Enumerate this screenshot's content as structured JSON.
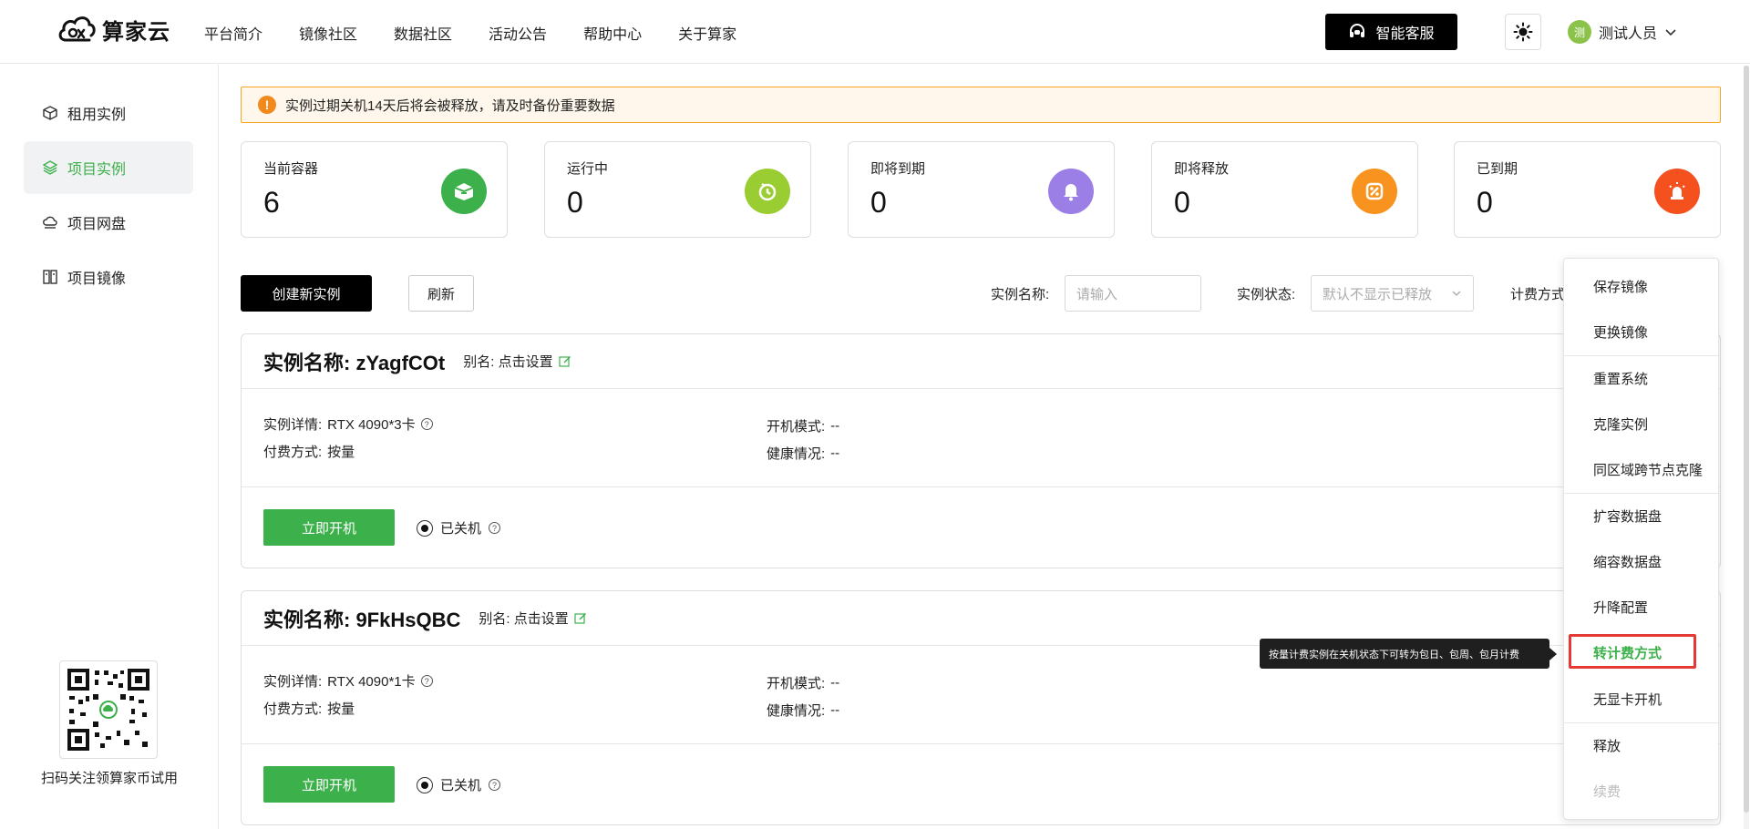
{
  "brand": {
    "name": "算家云"
  },
  "nav": [
    "平台简介",
    "镜像社区",
    "数据社区",
    "活动公告",
    "帮助中心",
    "关于算家"
  ],
  "header": {
    "service_label": "智能客服",
    "user_avatar_text": "测",
    "user_name": "测试人员"
  },
  "sidebar": {
    "items": [
      {
        "label": "租用实例",
        "icon": "cube-icon"
      },
      {
        "label": "项目实例",
        "icon": "layers-icon",
        "active": true
      },
      {
        "label": "项目网盘",
        "icon": "cloud-drive-icon"
      },
      {
        "label": "项目镜像",
        "icon": "image-stack-icon"
      }
    ],
    "qr_caption": "扫码关注领算家币试用"
  },
  "alert": {
    "text": "实例过期关机14天后将会被释放，请及时备份重要数据"
  },
  "stats": [
    {
      "label": "当前容器",
      "value": "6",
      "color": "#3cb04a"
    },
    {
      "label": "运行中",
      "value": "0",
      "color": "#9acd32"
    },
    {
      "label": "即将到期",
      "value": "0",
      "color": "#9b7fe6"
    },
    {
      "label": "即将释放",
      "value": "0",
      "color": "#f7931e"
    },
    {
      "label": "已到期",
      "value": "0",
      "color": "#f4511e"
    }
  ],
  "toolbar": {
    "create_label": "创建新实例",
    "refresh_label": "刷新",
    "name_filter_label": "实例名称:",
    "name_filter_placeholder": "请输入",
    "status_filter_label": "实例状态:",
    "status_filter_placeholder": "默认不显示已释放",
    "billing_filter_label": "计费方式"
  },
  "instances": [
    {
      "title": "实例名称:  zYagfCOt",
      "alias": "别名: 点击设置",
      "detail_label": "实例详情:",
      "detail_value": "RTX 4090*3卡",
      "pay_label": "付费方式:",
      "pay_value": "按量",
      "boot_label": "开机模式:",
      "boot_value": "--",
      "health_label": "健康情况:",
      "health_value": "--",
      "start_label": "立即开机",
      "status": "已关机"
    },
    {
      "title": "实例名称:  9FkHsQBC",
      "alias": "别名: 点击设置",
      "detail_label": "实例详情:",
      "detail_value": "RTX 4090*1卡",
      "pay_label": "付费方式:",
      "pay_value": "按量",
      "boot_label": "开机模式:",
      "boot_value": "--",
      "health_label": "健康情况:",
      "health_value": "--",
      "start_label": "立即开机",
      "status": "已关机"
    }
  ],
  "menu": {
    "items": [
      "保存镜像",
      "更换镜像",
      "重置系统",
      "克隆实例",
      "同区域跨节点克隆",
      "扩容数据盘",
      "缩容数据盘",
      "升降配置",
      "转计费方式",
      "无显卡开机",
      "释放",
      "续费"
    ],
    "highlighted": "转计费方式",
    "disabled": "续费"
  },
  "tooltip": {
    "text": "按量计费实例在关机状态下可转为包日、包周、包月计费"
  },
  "colors": {
    "accent": "#3cb04a",
    "warning": "#f6a623",
    "highlight_box": "#e53935"
  }
}
